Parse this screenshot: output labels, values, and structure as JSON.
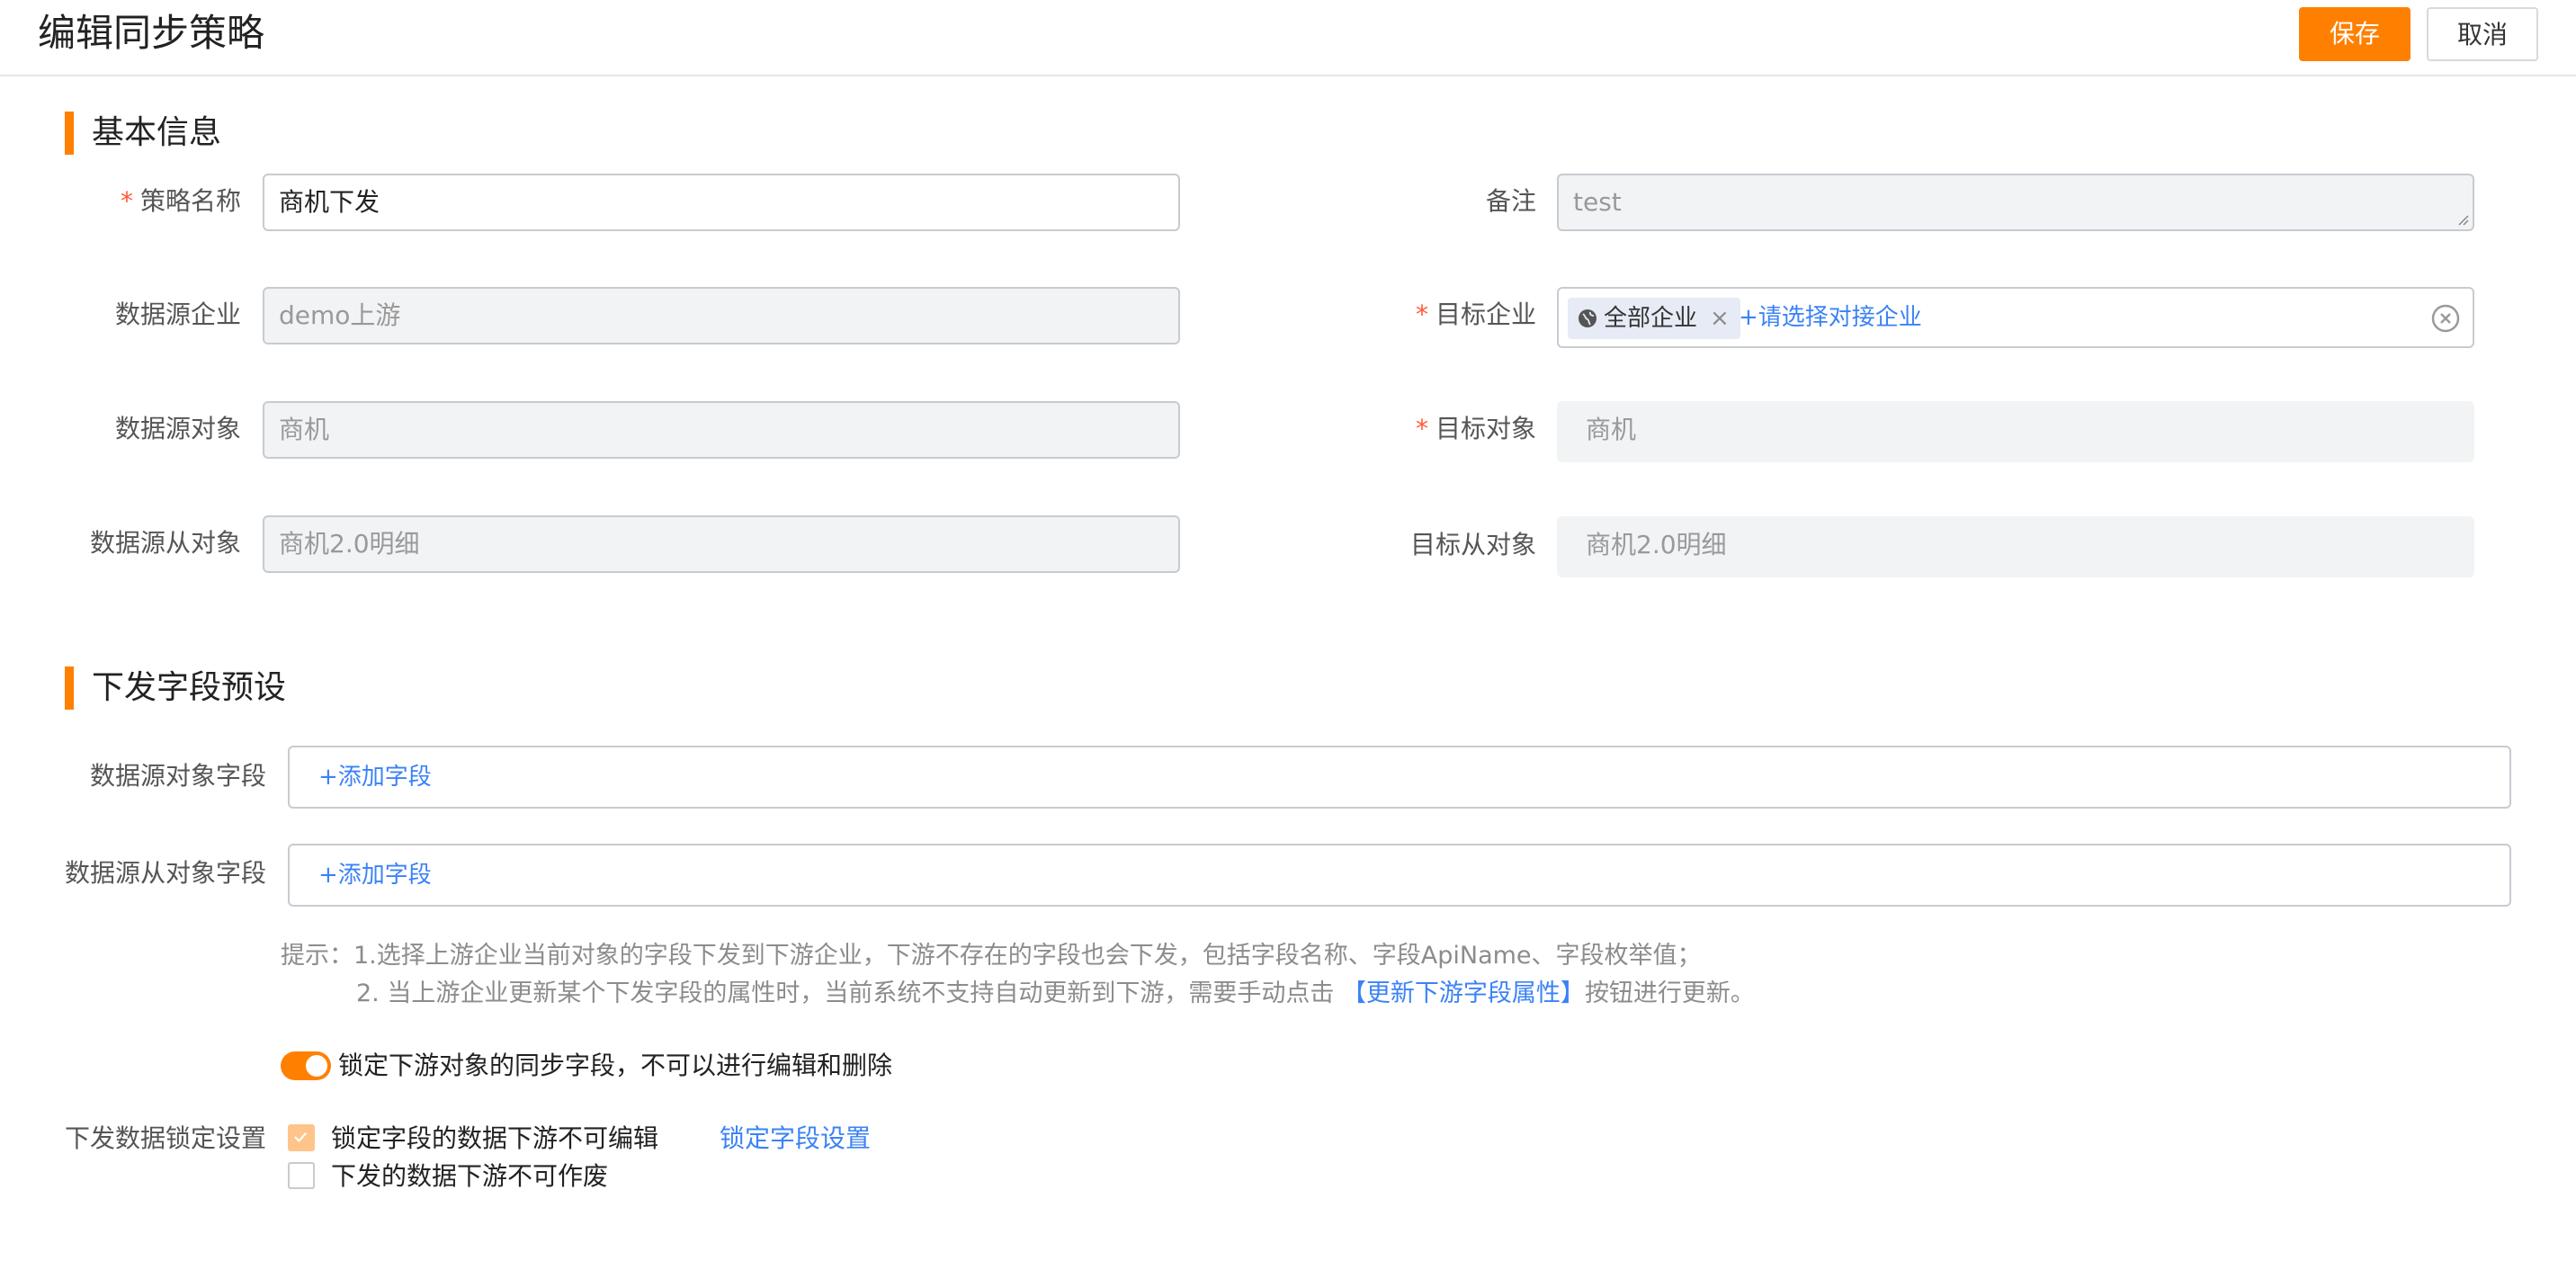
{
  "header": {
    "title": "编辑同步策略",
    "save_label": "保存",
    "cancel_label": "取消"
  },
  "basic_info": {
    "section_title": "基本信息",
    "required_mark": "*",
    "strategy_name": {
      "label": "策略名称",
      "value": "商机下发"
    },
    "remark": {
      "label": "备注",
      "value": "test"
    },
    "source_enterprise": {
      "label": "数据源企业",
      "value": "demo上游"
    },
    "target_enterprise": {
      "label": "目标企业",
      "tag": "全部企业",
      "tag_close": "×",
      "add_link": "+请选择对接企业"
    },
    "source_object": {
      "label": "数据源对象",
      "value": "商机"
    },
    "target_object": {
      "label": "目标对象",
      "value": "商机"
    },
    "source_sub_object": {
      "label": "数据源从对象",
      "value": "商机2.0明细"
    },
    "target_sub_object": {
      "label": "目标从对象",
      "value": "商机2.0明细"
    }
  },
  "field_preset": {
    "section_title": "下发字段预设",
    "source_object_fields": {
      "label": "数据源对象字段",
      "add_link": "+添加字段"
    },
    "source_sub_object_fields": {
      "label": "数据源从对象字段",
      "add_link": "+添加字段"
    },
    "tip_line1": "提示：1.选择上游企业当前对象的字段下发到下游企业，下游不存在的字段也会下发，包括字段名称、字段ApiName、字段枚举值；",
    "tip_line2_pre": "2. 当上游企业更新某个下发字段的属性时，当前系统不支持自动更新到下游，需要手动点击 ",
    "tip_line2_link": "【更新下游字段属性】",
    "tip_line2_post": "按钮进行更新。",
    "lock_switch": {
      "on": true,
      "label": "锁定下游对象的同步字段，不可以进行编辑和删除"
    }
  },
  "lock_settings": {
    "label": "下发数据锁定设置",
    "option1": {
      "checked": true,
      "label": "锁定字段的数据下游不可编辑"
    },
    "option1_link": "锁定字段设置",
    "option2": {
      "checked": false,
      "label": "下发的数据下游不可作废"
    }
  },
  "colors": {
    "accent": "#ff8000",
    "link": "#3b82f6",
    "required": "#ff5a36"
  },
  "icons": {
    "globe": "globe-icon",
    "clear": "clear-circle-icon",
    "check": "check-icon"
  }
}
